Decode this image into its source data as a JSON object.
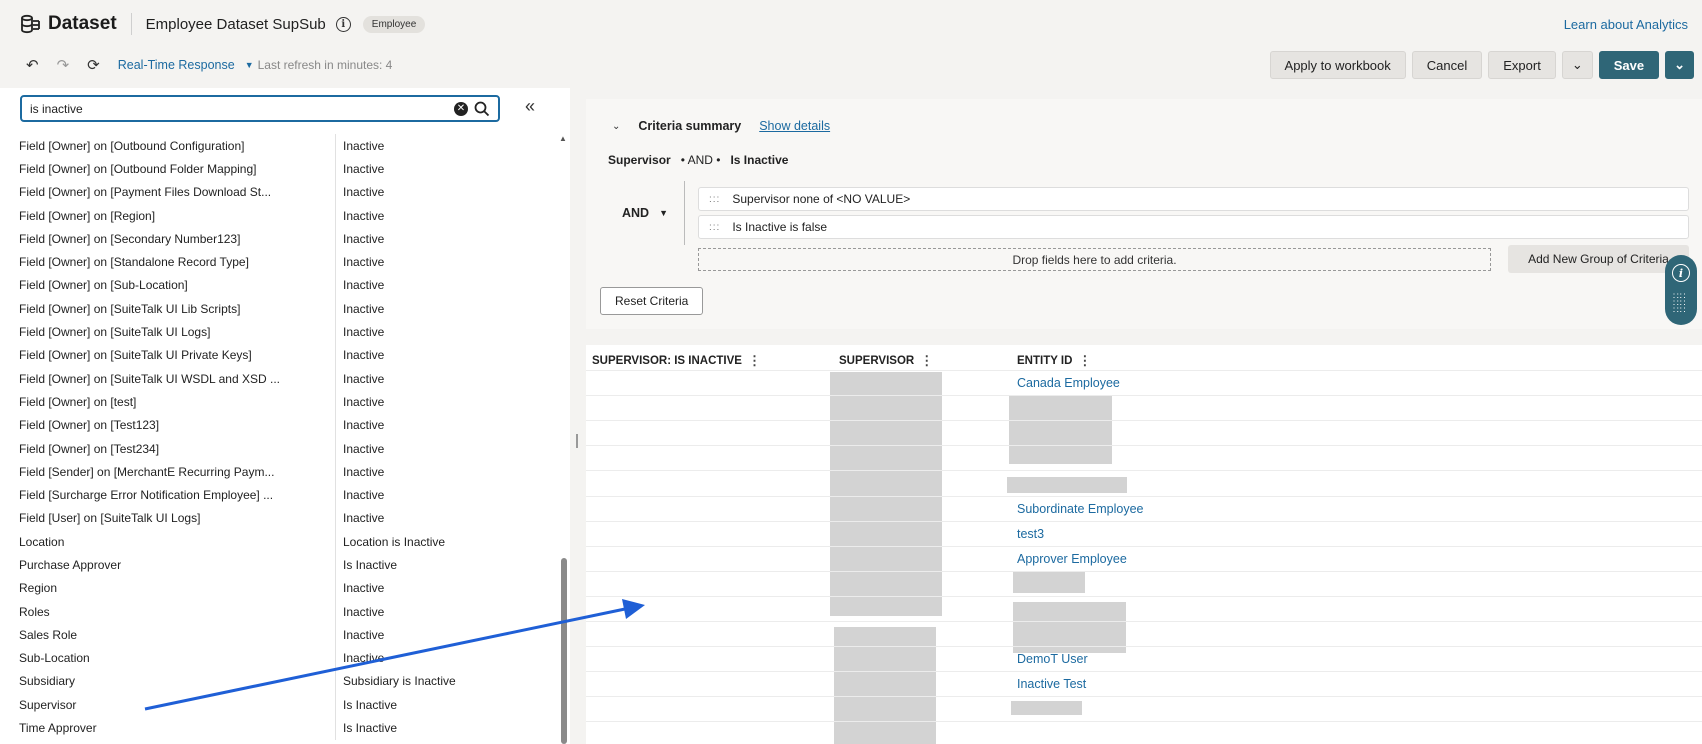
{
  "header": {
    "logo_label": "Dataset",
    "title": "Employee Dataset SupSub",
    "info_icon": "i",
    "badge": "Employee",
    "learn_link": "Learn about Analytics"
  },
  "toolbar": {
    "realtime": "Real-Time Response",
    "last_refresh": "Last refresh in minutes: 4",
    "apply": "Apply to workbook",
    "cancel": "Cancel",
    "export": "Export",
    "save": "Save"
  },
  "search": {
    "value": "is inactive"
  },
  "results": [
    [
      "Field [Owner] on [Outbound Configuration]",
      "Inactive"
    ],
    [
      "Field [Owner] on [Outbound Folder Mapping]",
      "Inactive"
    ],
    [
      "Field [Owner] on [Payment Files Download St...",
      "Inactive"
    ],
    [
      "Field [Owner] on [Region]",
      "Inactive"
    ],
    [
      "Field [Owner] on [Secondary Number123]",
      "Inactive"
    ],
    [
      "Field [Owner] on [Standalone Record Type]",
      "Inactive"
    ],
    [
      "Field [Owner] on [Sub-Location]",
      "Inactive"
    ],
    [
      "Field [Owner] on [SuiteTalk UI Lib Scripts]",
      "Inactive"
    ],
    [
      "Field [Owner] on [SuiteTalk UI Logs]",
      "Inactive"
    ],
    [
      "Field [Owner] on [SuiteTalk UI Private Keys]",
      "Inactive"
    ],
    [
      "Field [Owner] on [SuiteTalk UI WSDL and XSD ...",
      "Inactive"
    ],
    [
      "Field [Owner] on [test]",
      "Inactive"
    ],
    [
      "Field [Owner] on [Test123]",
      "Inactive"
    ],
    [
      "Field [Owner] on [Test234]",
      "Inactive"
    ],
    [
      "Field [Sender] on [MerchantE Recurring Paym...",
      "Inactive"
    ],
    [
      "Field [Surcharge Error Notification Employee] ...",
      "Inactive"
    ],
    [
      "Field [User] on [SuiteTalk UI Logs]",
      "Inactive"
    ],
    [
      "Location",
      "Location is Inactive"
    ],
    [
      "Purchase Approver",
      "Is Inactive"
    ],
    [
      "Region",
      "Inactive"
    ],
    [
      "Roles",
      "Inactive"
    ],
    [
      "Sales Role",
      "Inactive"
    ],
    [
      "Sub-Location",
      "Inactive"
    ],
    [
      "Subsidiary",
      "Subsidiary is Inactive"
    ],
    [
      "Supervisor",
      "Is Inactive"
    ],
    [
      "Time Approver",
      "Is Inactive"
    ]
  ],
  "criteria": {
    "summary_title": "Criteria summary",
    "show_details": "Show details",
    "summary": {
      "left": "Supervisor",
      "op": "• AND •",
      "right": "Is Inactive"
    },
    "group_operator": "AND",
    "items": [
      "Supervisor none of <NO VALUE>",
      "Is Inactive is false"
    ],
    "drop_hint": "Drop fields here to add criteria.",
    "add_group": "Add New Group of Criteria",
    "reset": "Reset Criteria"
  },
  "table": {
    "columns": [
      "SUPERVISOR: IS INACTIVE",
      "SUPERVISOR",
      "ENTITY ID"
    ],
    "entity_links": [
      {
        "text": "Canada Employee",
        "row": 0
      },
      {
        "text": "Subordinate Employee",
        "row": 5
      },
      {
        "text": "test3",
        "row": 6
      },
      {
        "text": "Approver Employee",
        "row": 7
      },
      {
        "text": "DemoT User",
        "row": 11
      },
      {
        "text": "Inactive Test",
        "row": 12
      }
    ]
  },
  "colors": {
    "accent": "#1c6aa0",
    "primary": "#2f6677",
    "arrow": "#1f5fd6"
  }
}
